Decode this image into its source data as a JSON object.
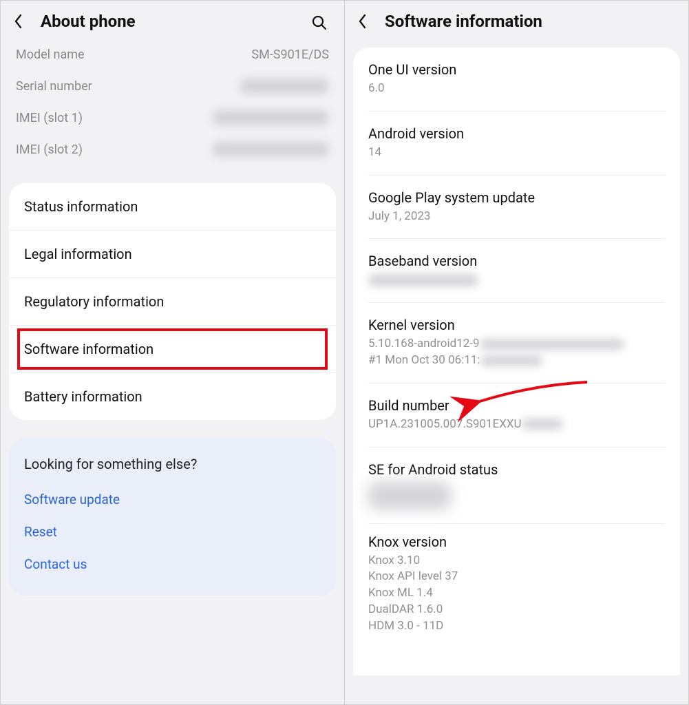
{
  "left": {
    "title": "About phone",
    "device": {
      "model_label": "Model name",
      "model_value": "SM-S901E/DS",
      "serial_label": "Serial number",
      "imei1_label": "IMEI (slot 1)",
      "imei2_label": "IMEI (slot 2)"
    },
    "menu": {
      "status": "Status information",
      "legal": "Legal information",
      "regulatory": "Regulatory information",
      "software": "Software information",
      "battery": "Battery information"
    },
    "suggest": {
      "title": "Looking for something else?",
      "link1": "Software update",
      "link2": "Reset",
      "link3": "Contact us"
    }
  },
  "right": {
    "title": "Software information",
    "oneui": {
      "label": "One UI version",
      "value": "6.0"
    },
    "android": {
      "label": "Android version",
      "value": "14"
    },
    "gplay": {
      "label": "Google Play system update",
      "value": "July 1, 2023"
    },
    "baseband": {
      "label": "Baseband version"
    },
    "kernel": {
      "label": "Kernel version",
      "line1_prefix": "5.10.168-android12-9",
      "line2_prefix": "#1 Mon Oct 30 06:11:"
    },
    "build": {
      "label": "Build number",
      "value_prefix": "UP1A.231005.007.S901EXXU"
    },
    "se": {
      "label": "SE for Android status"
    },
    "knox": {
      "label": "Knox version",
      "lines": [
        "Knox 3.10",
        "Knox API level 37",
        "Knox ML 1.4",
        "DualDAR 1.6.0",
        "HDM 3.0 - 11D"
      ]
    }
  }
}
